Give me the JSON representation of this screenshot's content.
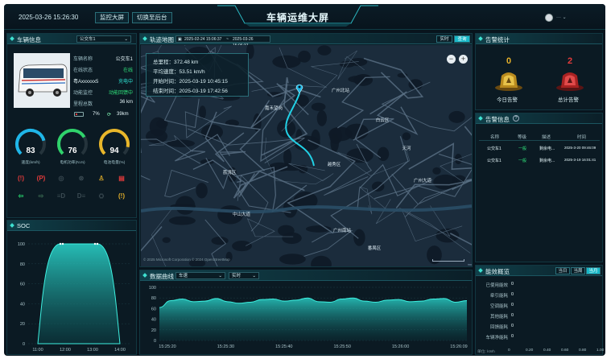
{
  "header": {
    "datetime": "2025-03-26 15:26:30",
    "btn_monitor": "监控大屏",
    "btn_backend": "切换至后台",
    "title": "车辆运维大屏",
    "user": "···  ⌄"
  },
  "vehicle_info": {
    "title": "车辆信息",
    "select_value": "公交车1",
    "rows": [
      {
        "label": "车辆名称",
        "value": "公交车1"
      },
      {
        "label": "在线状态",
        "value": "在线"
      },
      {
        "label": "粤Axxxxxx5",
        "value": "充电中"
      },
      {
        "label": "动能监控",
        "value": "动能回馈中"
      },
      {
        "label": "里程总数",
        "value": "36 km"
      }
    ],
    "battery_pct": "7%",
    "range": "39km",
    "gauges": [
      {
        "value": "83",
        "label": "速度(km/h)",
        "color": "#1fb6e8",
        "fraction": 0.78
      },
      {
        "value": "76",
        "label": "电机功率(N.m)",
        "color": "#2fd26b",
        "fraction": 0.72
      },
      {
        "value": "94",
        "label": "电池电量(%)",
        "color": "#e8b62a",
        "fraction": 0.88
      }
    ],
    "warning_icons": [
      "brake-warning-icon",
      "abs-warning-icon",
      "steering-warning-icon",
      "tire-warning-icon",
      "seatbelt-icon",
      "door-open-icon",
      "left-turn-icon",
      "right-turn-icon",
      "low-beam-icon",
      "high-beam-icon",
      "engine-icon",
      "tire-pressure-icon"
    ]
  },
  "soc": {
    "title": "SOC",
    "y_ticks": [
      "100",
      "80",
      "60",
      "40",
      "20",
      "0"
    ],
    "x_ticks": [
      "11:00",
      "12:00",
      "13:00",
      "14:00"
    ]
  },
  "track_map": {
    "title": "轨迹地图",
    "date_start": "2025-02-24 15:06:37",
    "range_sep": "~",
    "date_end": "2025-03-26 15:06:37",
    "btn_live": "实时",
    "btn_query": "查询",
    "info": {
      "total_mileage": "总里程：372.48 km",
      "avg_speed": "平均速度：53.51 km/h",
      "start_time": "开始时间：2025-03-19 10:45:15",
      "end_time": "结束时间：2025-03-19 17:42:56"
    },
    "places": [
      "嘉禾望岗",
      "广州北站",
      "白云区",
      "天河",
      "越秀区",
      "荔湾区",
      "广州南站",
      "番禺区",
      "中山大道",
      "广州大道"
    ],
    "copyright": "© 2025 Microsoft Corporation  © 2024 OpenStreetMap"
  },
  "data_curve": {
    "title": "数据曲线",
    "select_metric": "车速",
    "select_mode": "实时",
    "y_ticks": [
      "100",
      "80",
      "60",
      "40",
      "20",
      "0"
    ],
    "x_ticks": [
      "15:25:20",
      "15:25:30",
      "15:25:40",
      "15:25:50",
      "15:26:00",
      "15:26:09"
    ]
  },
  "alarm_stats": {
    "title": "告警统计",
    "today_count": "0",
    "today_label": "今日告警",
    "total_count": "2",
    "total_label": "总计告警"
  },
  "alarm_info": {
    "title": "告警信息",
    "headers": [
      "名称",
      "等级",
      "描述",
      "时间"
    ],
    "rows": [
      {
        "name": "公交车1",
        "level": "一般",
        "desc": "剩余电...",
        "time": "2025-3-20 09:46:09"
      },
      {
        "name": "公交车1",
        "level": "一般",
        "desc": "剩余电...",
        "time": "2025-3-19 16:01:41"
      }
    ]
  },
  "energy": {
    "title": "能效概览",
    "tabs": [
      "当日",
      "当周",
      "当月"
    ],
    "active_tab": "当月",
    "rows": [
      {
        "label": "已使用能效",
        "value": "0"
      },
      {
        "label": "牵引能耗",
        "value": "0"
      },
      {
        "label": "空调能耗",
        "value": "0"
      },
      {
        "label": "其他能耗",
        "value": "0"
      },
      {
        "label": "回馈能耗",
        "value": "0"
      },
      {
        "label": "车辆净能耗",
        "value": "0"
      }
    ],
    "x_ticks": [
      "0",
      "0.20",
      "0.40",
      "0.60",
      "0.80",
      "1.00"
    ],
    "unit": "单位: kWh"
  },
  "colors": {
    "accent": "#2ee6d6",
    "red": "#e23b3b",
    "gold": "#e6b12a",
    "green": "#27d36d"
  }
}
